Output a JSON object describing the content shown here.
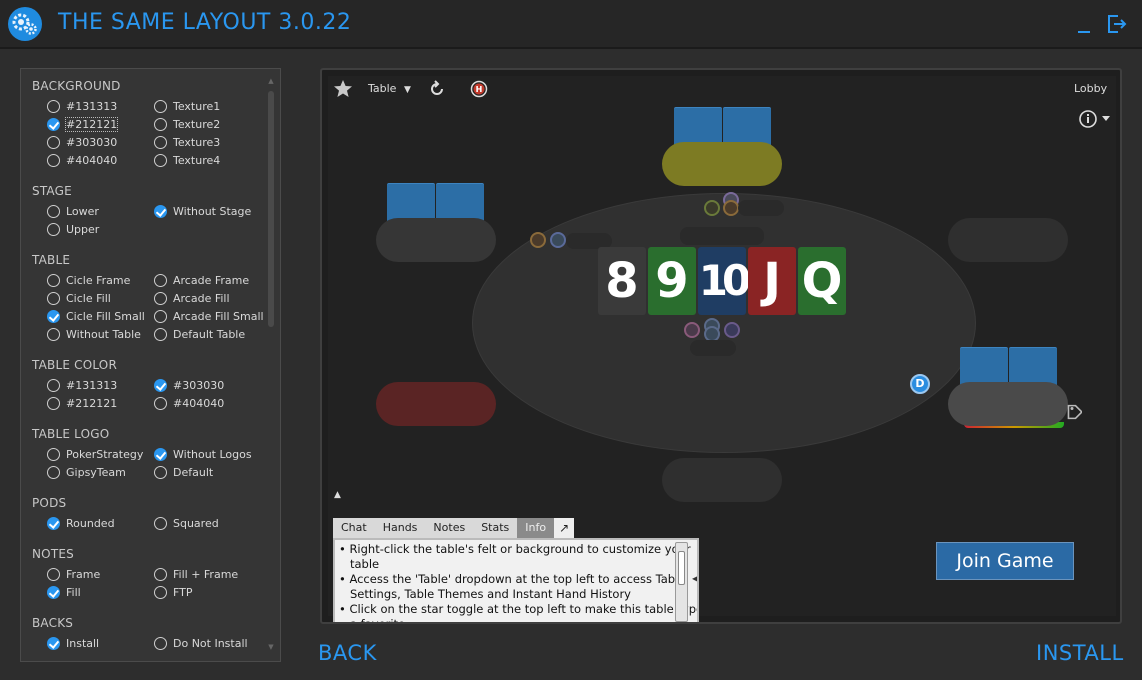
{
  "app": {
    "title": "THE SAME LAYOUT 3.0.22"
  },
  "colors": {
    "accent": "#2a97f0",
    "panel": "#353535",
    "join_button": "#2b6aa5"
  },
  "settings": {
    "sections": [
      {
        "title": "BACKGROUND",
        "options": [
          {
            "label": "#131313",
            "checked": false
          },
          {
            "label": "Texture1",
            "checked": false
          },
          {
            "label": "#212121",
            "checked": true
          },
          {
            "label": "Texture2",
            "checked": false
          },
          {
            "label": "#303030",
            "checked": false
          },
          {
            "label": "Texture3",
            "checked": false
          },
          {
            "label": "#404040",
            "checked": false
          },
          {
            "label": "Texture4",
            "checked": false
          }
        ]
      },
      {
        "title": "STAGE",
        "options": [
          {
            "label": "Lower",
            "checked": false
          },
          {
            "label": "Without Stage",
            "checked": true
          },
          {
            "label": "Upper",
            "checked": false
          }
        ]
      },
      {
        "title": "TABLE",
        "options": [
          {
            "label": "Cicle Frame",
            "checked": false
          },
          {
            "label": "Arcade Frame",
            "checked": false
          },
          {
            "label": "Cicle Fill",
            "checked": false
          },
          {
            "label": "Arcade Fill",
            "checked": false
          },
          {
            "label": "Cicle Fill Small",
            "checked": true
          },
          {
            "label": "Arcade Fill Small",
            "checked": false
          },
          {
            "label": "Without Table",
            "checked": false
          },
          {
            "label": "Default Table",
            "checked": false
          }
        ]
      },
      {
        "title": "TABLE COLOR",
        "options": [
          {
            "label": "#131313",
            "checked": false
          },
          {
            "label": "#303030",
            "checked": true
          },
          {
            "label": "#212121",
            "checked": false
          },
          {
            "label": "#404040",
            "checked": false
          }
        ]
      },
      {
        "title": "TABLE LOGO",
        "options": [
          {
            "label": "PokerStrategy",
            "checked": false
          },
          {
            "label": "Without Logos",
            "checked": true
          },
          {
            "label": "GipsyTeam",
            "checked": false
          },
          {
            "label": "Default",
            "checked": false
          }
        ]
      },
      {
        "title": "PODS",
        "options": [
          {
            "label": "Rounded",
            "checked": true
          },
          {
            "label": "Squared",
            "checked": false
          }
        ]
      },
      {
        "title": "NOTES",
        "options": [
          {
            "label": "Frame",
            "checked": false
          },
          {
            "label": "Fill + Frame",
            "checked": false
          },
          {
            "label": "Fill",
            "checked": true
          },
          {
            "label": "FTP",
            "checked": false
          }
        ]
      },
      {
        "title": "BACKS",
        "options": [
          {
            "label": "Install",
            "checked": true
          },
          {
            "label": "Do Not Install",
            "checked": false
          }
        ]
      }
    ]
  },
  "nav": {
    "back": "BACK",
    "install": "INSTALL"
  },
  "preview": {
    "toolbar": {
      "table_label": "Table",
      "lobby_label": "Lobby"
    },
    "board_cards": [
      {
        "rank": "8",
        "color": "#3a3a3a"
      },
      {
        "rank": "9",
        "color": "#2a6e2e"
      },
      {
        "rank": "10",
        "color": "#1f3d63"
      },
      {
        "rank": "J",
        "color": "#8a2424"
      },
      {
        "rank": "Q",
        "color": "#2a6e2e"
      }
    ],
    "dealer_label": "D",
    "tabs": [
      {
        "label": "Chat",
        "active": false
      },
      {
        "label": "Hands",
        "active": false
      },
      {
        "label": "Notes",
        "active": false
      },
      {
        "label": "Stats",
        "active": false
      },
      {
        "label": "Info",
        "active": true
      }
    ],
    "info_lines": [
      "• Right-click the table's felt or background to customize your",
      "   table",
      "• Access the 'Table' dropdown at the top left to access Table",
      "   Settings, Table Themes and Instant Hand History",
      "• Click on the star toggle at the top left to make this table type",
      "   a favorite"
    ],
    "join_button": "Join Game"
  }
}
